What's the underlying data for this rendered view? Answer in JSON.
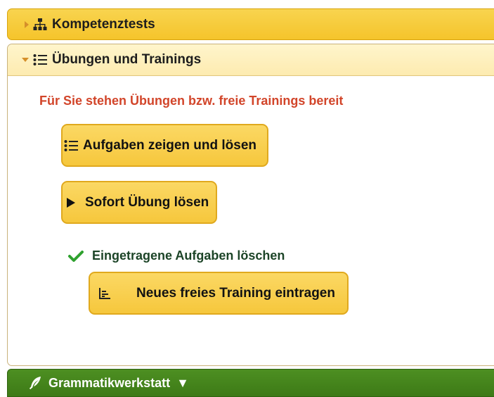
{
  "panels": {
    "kompetenztests": {
      "title": "Kompetenztests"
    },
    "uebungen": {
      "title": "Übungen und Trainings",
      "intro": "Für Sie stehen Übungen bzw. freie Trainings bereit",
      "buttons": {
        "aufgaben": "Aufgaben zeigen und lösen",
        "sofort": "Sofort Übung lösen",
        "neues": "Neues freies Training eintragen"
      },
      "delete_link": "Eingetragene Aufgaben löschen"
    },
    "grammatik": {
      "title": "Grammatikwerkstatt",
      "arrow": "▼"
    }
  },
  "icons": {
    "kompetenztests": "sitemap-icon",
    "uebungen": "list-icon",
    "aufgaben": "list-icon",
    "sofort": "play-icon",
    "loeschen": "check-icon",
    "neues": "chart-icon",
    "grammatik": "feather-icon"
  },
  "colors": {
    "panel_yellow": "#f6c73c",
    "header_light": "#fdebb0",
    "intro_red": "#d2452a",
    "check_green": "#2fa12f",
    "grammar_green": "#3d7a16"
  }
}
